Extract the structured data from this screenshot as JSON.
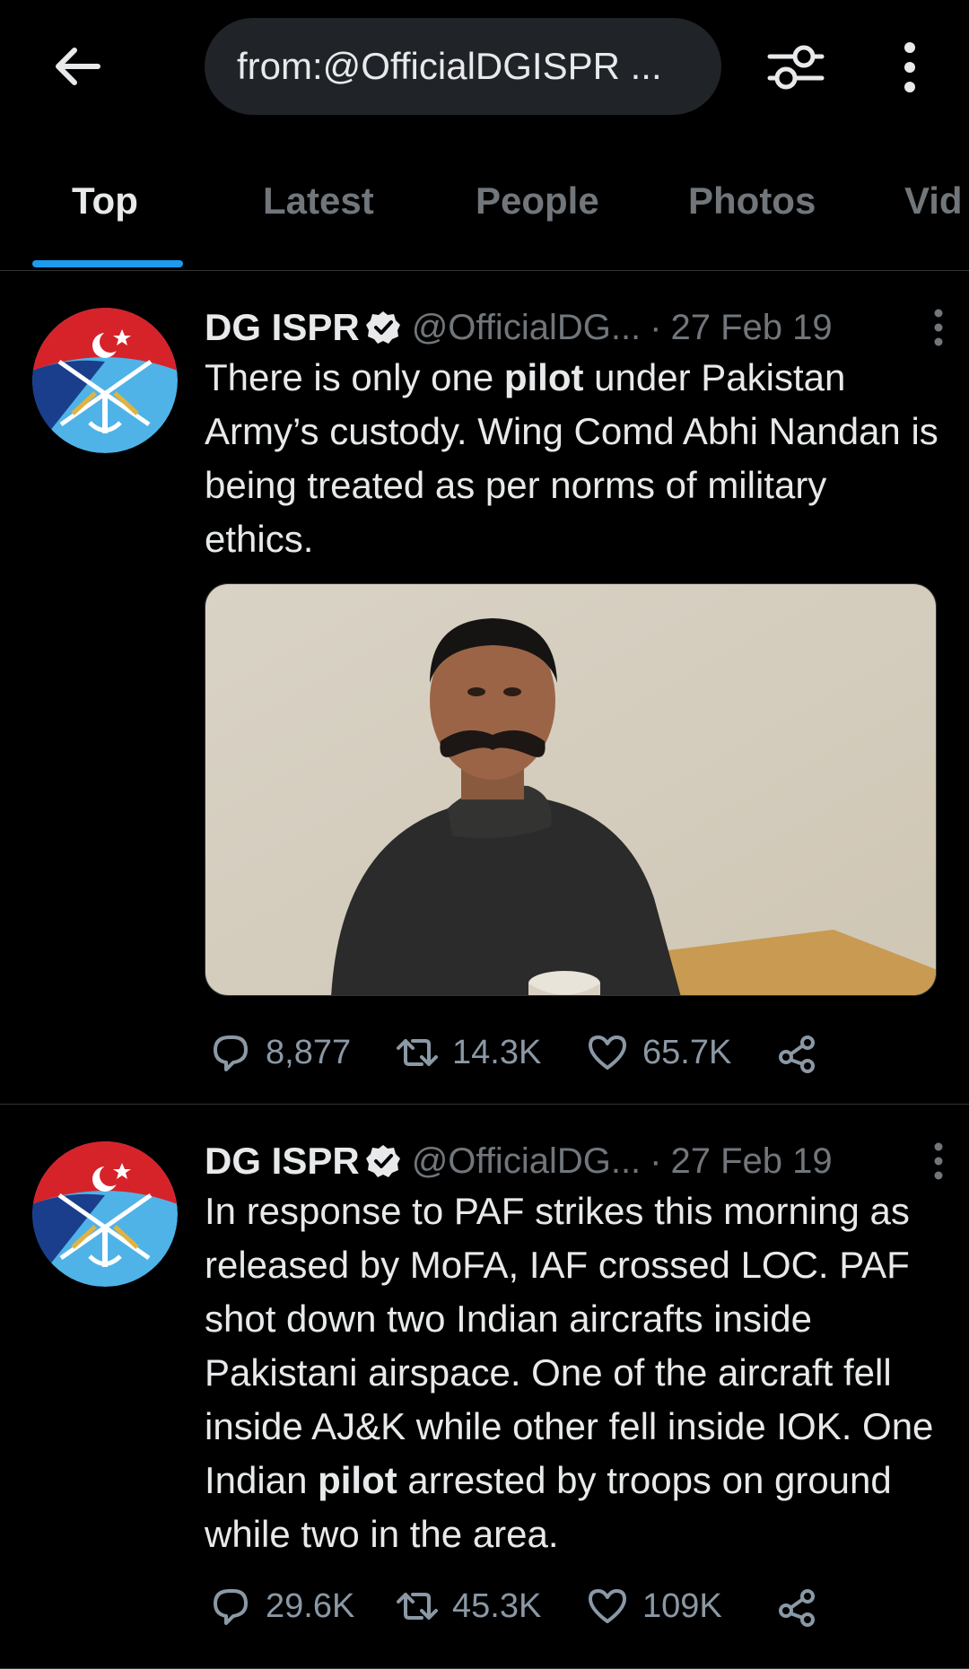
{
  "header": {
    "search_query": "from:@OfficialDGISPR ...",
    "back_icon": "arrow-left-icon",
    "filter_icon": "sliders-icon",
    "more_icon": "more-vertical-icon"
  },
  "tabs": [
    {
      "label": "Top",
      "active": true
    },
    {
      "label": "Latest",
      "active": false
    },
    {
      "label": "People",
      "active": false
    },
    {
      "label": "Photos",
      "active": false
    },
    {
      "label": "Vid",
      "active": false
    }
  ],
  "colors": {
    "background": "#000000",
    "accent": "#1d9bf0",
    "secondary_text": "#71767b"
  },
  "tweets": [
    {
      "author": "DG ISPR",
      "handle": "@OfficialDG...",
      "separator": "·",
      "date": "27 Feb 19",
      "verified": true,
      "text_parts": [
        "There is only one ",
        "pilot",
        " under Pakistan Army’s custody. Wing Comd Abhi Nandan is being treated as per norms of military ethics."
      ],
      "has_image": true,
      "replies": "8,877",
      "retweets": "14.3K",
      "likes": "65.7K"
    },
    {
      "author": "DG ISPR",
      "handle": "@OfficialDG...",
      "separator": "·",
      "date": "27 Feb 19",
      "verified": true,
      "text_parts": [
        "In response to PAF strikes this morning as released by MoFA, IAF crossed LOC. PAF shot down two Indian aircrafts inside Pakistani airspace. One of the aircraft fell inside AJ&K while other fell inside IOK. One Indian ",
        "pilot",
        " arrested by troops on ground while two in the area."
      ],
      "has_image": false,
      "replies": "29.6K",
      "retweets": "45.3K",
      "likes": "109K"
    }
  ]
}
